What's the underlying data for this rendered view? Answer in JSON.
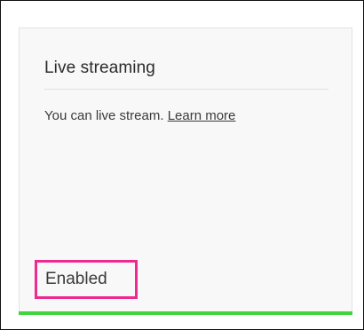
{
  "card": {
    "title": "Live streaming",
    "description": "You can live stream.",
    "learn_more": "Learn more",
    "status": "Enabled"
  },
  "colors": {
    "status_bar": "#3ed63a",
    "highlight_border": "#ec2a8f"
  }
}
